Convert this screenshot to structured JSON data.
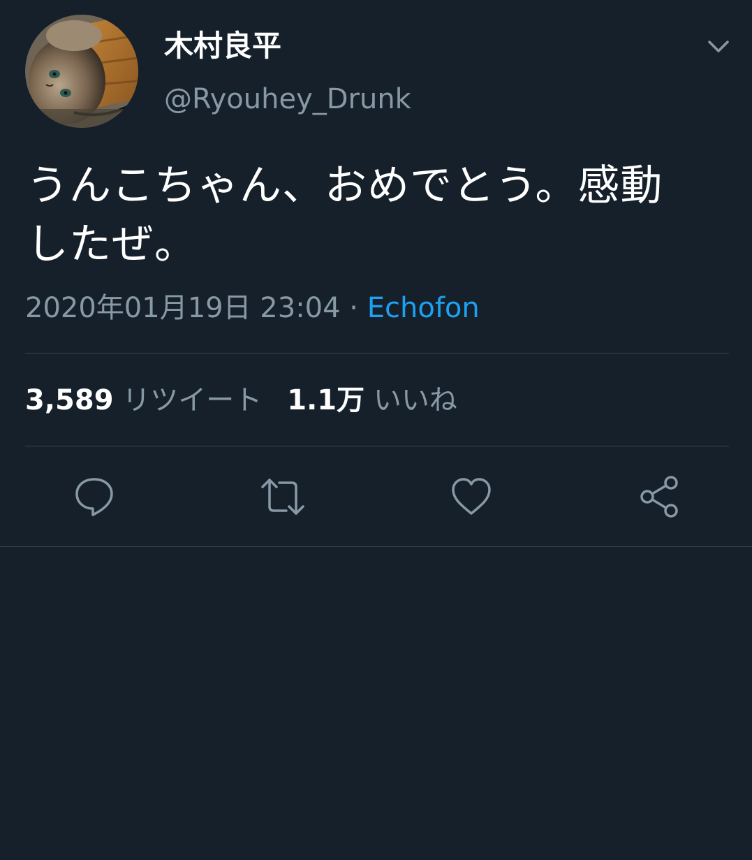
{
  "tweet": {
    "display_name": "木村良平",
    "handle": "@Ryouhey_Drunk",
    "text_line1": "うんこちゃん、おめでとう。感動",
    "text_line2": "したぜ。",
    "timestamp": "2020年01月19日 23:04",
    "separator": " · ",
    "source": "Echofon"
  },
  "stats": {
    "retweet_count": "3,589",
    "retweet_label": "リツイート",
    "like_count": "1.1万",
    "like_label": "いいね"
  },
  "icons": {
    "caret": "chevron-down-icon",
    "reply": "reply-icon",
    "retweet": "retweet-icon",
    "like": "heart-icon",
    "share": "share-icon"
  },
  "colors": {
    "background": "#15202b",
    "text_primary": "#ffffff",
    "text_secondary": "#8899a6",
    "link": "#1da1f2",
    "divider": "#38444d"
  }
}
